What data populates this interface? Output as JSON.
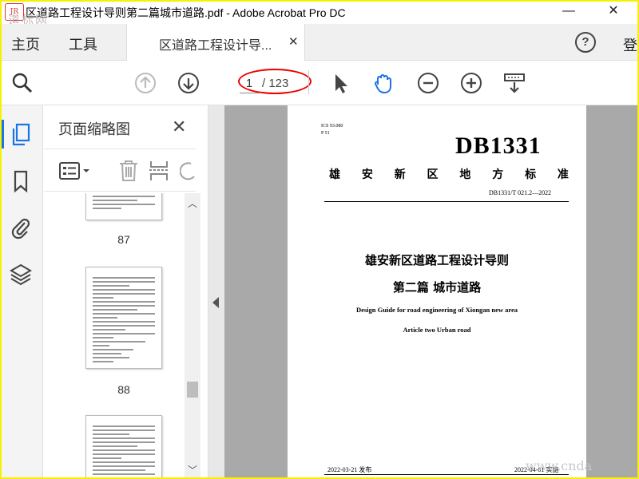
{
  "window": {
    "title": "区道路工程设计导则第二篇城市道路.pdf - Adobe Acrobat Pro DC",
    "logo_text": "JR",
    "watermark_top": "道标网",
    "minimize": "—",
    "close": "✕"
  },
  "tabs": {
    "home": "主页",
    "tools": "工具",
    "document_tab": "区道路工程设计导...",
    "close": "✕",
    "help": "?",
    "login": "登"
  },
  "toolbar": {
    "current_page": "1",
    "total_pages": "/ 123",
    "icons": [
      "search-icon",
      "page-up-icon",
      "page-down-icon",
      "select-pointer-icon",
      "hand-icon",
      "zoom-out-icon",
      "zoom-in-icon",
      "scroll-mode-icon"
    ]
  },
  "panel": {
    "title": "页面缩略图",
    "close": "✕",
    "thumbnails": [
      {
        "label": "87"
      },
      {
        "label": "88"
      },
      {
        "label": ""
      }
    ]
  },
  "document": {
    "ics": "ICS 93.080",
    "ccs": "P 51",
    "standard_code": "DB1331",
    "standard_type_chars": [
      "雄",
      "安",
      "新",
      "区",
      "地",
      "方",
      "标",
      "准"
    ],
    "doc_number": "DB1331/T 021.2—2022",
    "title_cn_1": "雄安新区道路工程设计导则",
    "title_cn_2": "第二篇  城市道路",
    "title_en_1": "Design Guide for road engineering of Xiongan new area",
    "title_en_2": "Article two    Urban road",
    "publish_date": "2022-03-21 发布",
    "implement_date": "2022-04-01 实施"
  },
  "watermark_bottom": "www.cnda",
  "colors": {
    "accent": "#1a73e8",
    "border_yellow": "#f5f200",
    "annotation_red": "#e00000"
  }
}
